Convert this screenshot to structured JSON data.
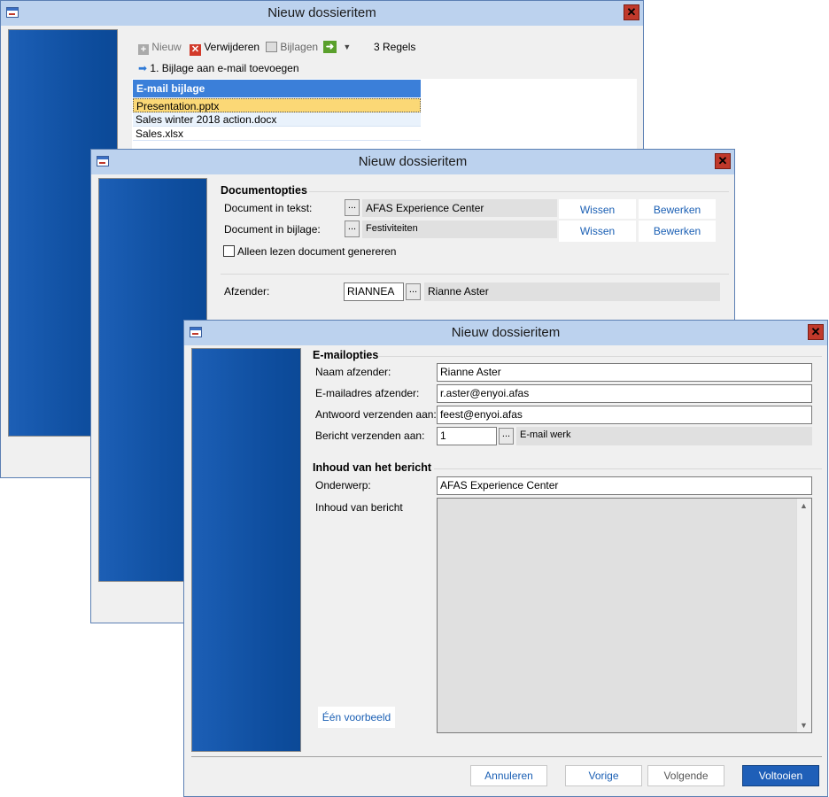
{
  "window1": {
    "title": "Nieuw dossieritem",
    "toolbar": {
      "new_label": "Nieuw",
      "delete_label": "Verwijderen",
      "attachments_label": "Bijlagen",
      "count_label": "3 Regels"
    },
    "step_label": "1. Bijlage aan e-mail toevoegen",
    "grid": {
      "header": "E-mail bijlage",
      "rows": [
        "Presentation.pptx",
        "Sales winter 2018 action.docx",
        "Sales.xlsx"
      ]
    }
  },
  "window2": {
    "title": "Nieuw dossieritem",
    "section_title": "Documentopties",
    "doc_text_label": "Document in tekst:",
    "doc_text_value": "AFAS Experience Center",
    "doc_attach_label": "Document in bijlage:",
    "doc_attach_value": "Festiviteiten",
    "dots": "...",
    "clear_label": "Wissen",
    "edit_label": "Bewerken",
    "readonly_checkbox_label": "Alleen lezen document genereren",
    "readonly_checked": false,
    "sender_label": "Afzender:",
    "sender_code": "RIANNEA",
    "sender_name": "Rianne Aster"
  },
  "window3": {
    "title": "Nieuw dossieritem",
    "email_section": "E-mailopties",
    "sender_name_label": "Naam afzender:",
    "sender_name_value": "Rianne Aster",
    "sender_email_label": "E-mailadres afzender:",
    "sender_email_value": "r.aster@enyoi.afas",
    "reply_to_label": "Antwoord verzenden aan:",
    "reply_to_value": "feest@enyoi.afas",
    "send_to_label": "Bericht verzenden aan:",
    "send_to_code": "1",
    "send_to_desc": "E-mail werk",
    "content_section": "Inhoud van het bericht",
    "subject_label": "Onderwerp:",
    "subject_value": "AFAS Experience Center",
    "body_label": "Inhoud van bericht",
    "body_value": "",
    "example_button": "Één voorbeeld",
    "buttons": {
      "cancel": "Annuleren",
      "previous": "Vorige",
      "next": "Volgende",
      "finish": "Voltooien"
    }
  },
  "colors": {
    "titlebar": "#bcd2ee",
    "close": "#c0392b",
    "accent": "#1f5fb8",
    "grid_header": "#3b7fd9",
    "selected_row": "#fbd876"
  },
  "icons": [
    "app-icon",
    "close-icon",
    "plus-icon",
    "delete-icon",
    "attachments-icon",
    "arrow-right-icon",
    "chevron-down-icon",
    "step-arrow-icon",
    "scroll-up-icon",
    "scroll-down-icon"
  ]
}
